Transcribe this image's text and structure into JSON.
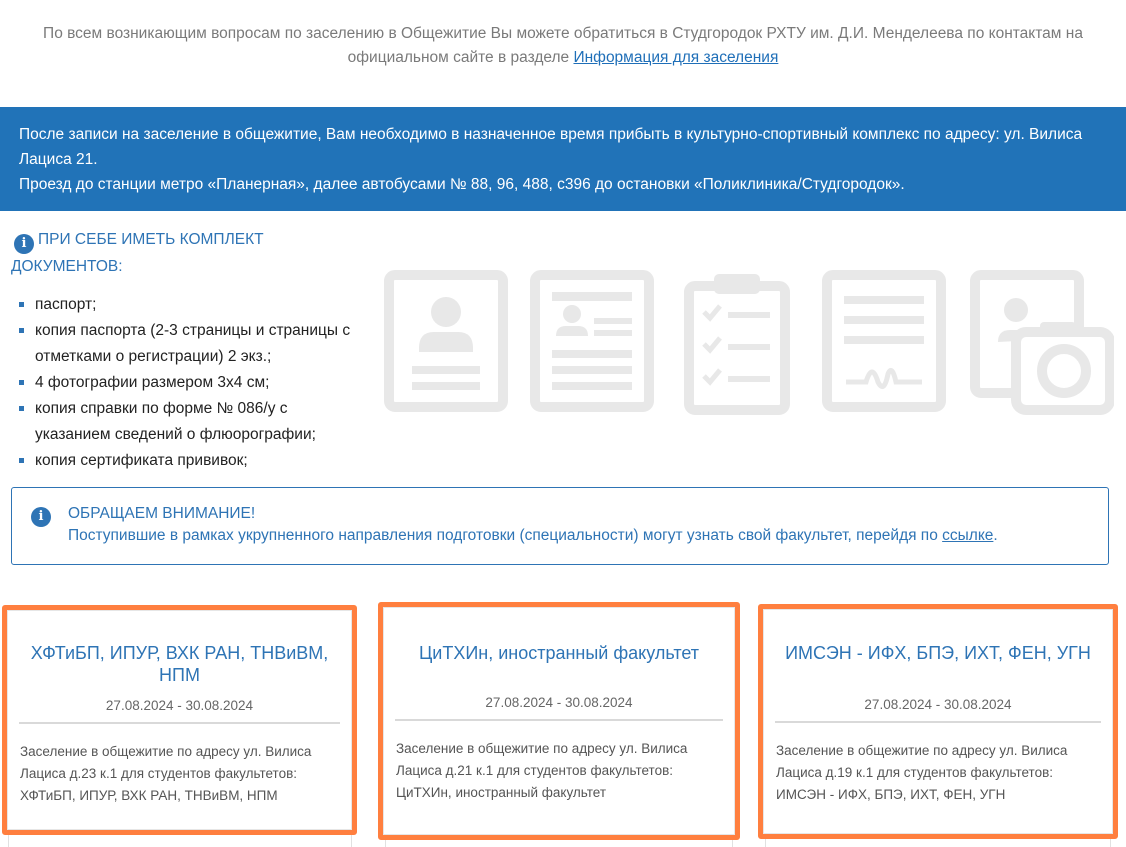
{
  "intro": {
    "text": "По всем возникающим вопросам по заселению в Общежитие Вы можете обратиться в Студгородок РХТУ им. Д.И. Менделеева по контактам на официальном сайте в разделе ",
    "link": "Информация для заселения"
  },
  "banner": {
    "line1": "После записи на заселение в общежитие, Вам необходимо в назначенное время прибыть в культурно-спортивный комплекс по адресу: ул. Вилиса Лациса 21.",
    "line2": "Проезд до станции метро «Планерная», далее автобусами № 88, 96, 488, с396 до остановки «Поликлиника/Студгородок»."
  },
  "documents": {
    "title": "ПРИ СЕБЕ ИМЕТЬ КОМПЛЕКТ ДОКУМЕНТОВ:",
    "items": [
      "паспорт;",
      "копия паспорта (2-3 страницы и страницы с отметками о регистрации) 2 экз.;",
      "4 фотографии размером 3х4 см;",
      "копия справки по форме № 086/у с указанием сведений о флюорографии;",
      "копия сертификата прививок;"
    ],
    "icons": [
      "id-card-icon",
      "profile-document-icon",
      "checklist-clipboard-icon",
      "signed-document-icon",
      "photo-camera-icon"
    ]
  },
  "notice": {
    "title": "ОБРАЩАЕМ ВНИМАНИЕ!",
    "text": "Поступившие в рамках укрупненного направления подготовки (специальности) могут узнать свой факультет, перейдя по ",
    "link": "ссылке",
    "tail": "."
  },
  "cards": [
    {
      "title": "ХФТиБП, ИПУР, ВХК РАН, ТНВиВМ, НПМ",
      "date": "27.08.2024 - 30.08.2024",
      "text": "Заселение в общежитие по адресу ул. Вилиса Лациса д.23 к.1 для студентов факультетов: ХФТиБП, ИПУР, ВХК РАН, ТНВиВМ, НПМ"
    },
    {
      "title": "ЦиТХИн, иностранный факультет",
      "date": "27.08.2024 - 30.08.2024",
      "text": "Заселение в общежитие по адресу ул. Вилиса Лациса д.21 к.1 для студентов факультетов: ЦиТХИн, иностранный факультет"
    },
    {
      "title": "ИМСЭН - ИФХ, БПЭ, ИХТ, ФЕН, УГН",
      "date": "27.08.2024 - 30.08.2024",
      "text": "Заселение в общежитие по адресу ул. Вилиса Лациса д.19 к.1 для студентов факультетов: ИМСЭН - ИФХ, БПЭ, ИХТ, ФЕН, УГН"
    }
  ],
  "colors": {
    "accent": "#2173b8",
    "highlight": "#ff7f3f",
    "icon_gray": "#e8e8e8"
  }
}
